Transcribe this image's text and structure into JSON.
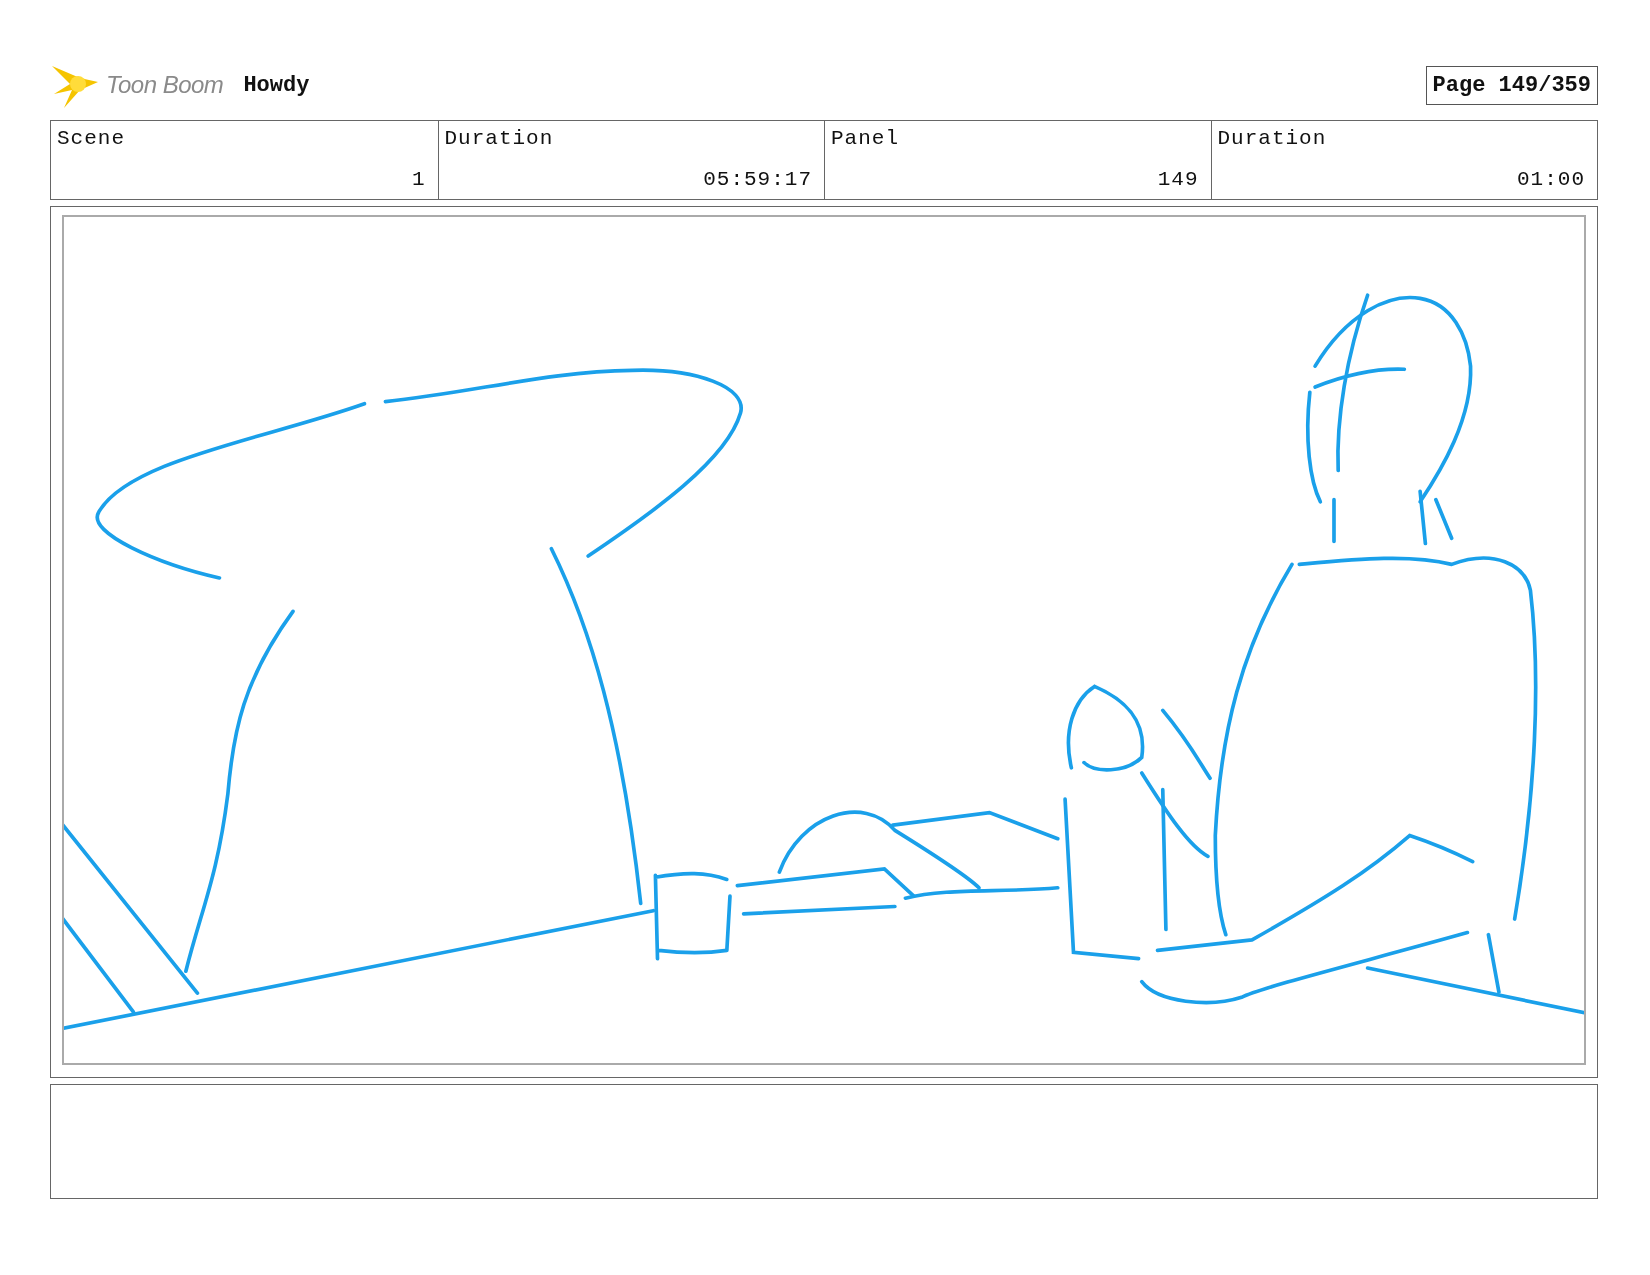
{
  "header": {
    "logo_text": "Toon Boom",
    "project": "Howdy",
    "page": "Page 149/359"
  },
  "fields": [
    {
      "label": "Scene",
      "value": "1"
    },
    {
      "label": "Duration",
      "value": "05:59:17"
    },
    {
      "label": "Panel",
      "value": "149"
    },
    {
      "label": "Duration",
      "value": "01:00"
    }
  ],
  "panel": {
    "kind": "sketch"
  }
}
